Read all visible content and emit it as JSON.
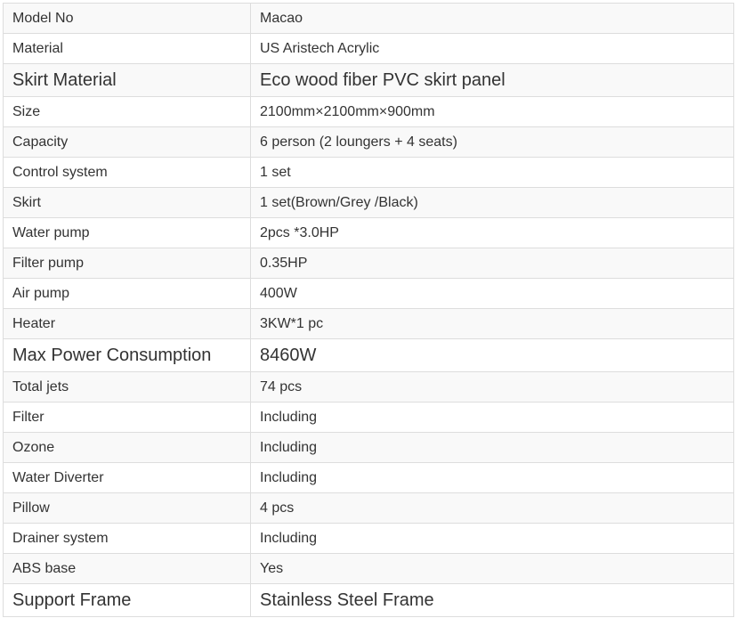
{
  "rows": [
    {
      "label": "Model No",
      "value": "Macao",
      "big": false
    },
    {
      "label": "Material",
      "value": "US Aristech Acrylic",
      "big": false
    },
    {
      "label": "Skirt Material",
      "value": "Eco wood fiber PVC skirt panel",
      "big": true
    },
    {
      "label": "Size",
      "value": "2100mm×2100mm×900mm",
      "big": false
    },
    {
      "label": "Capacity",
      "value": "6 person (2 loungers + 4 seats)",
      "big": false
    },
    {
      "label": "Control system",
      "value": "1 set",
      "big": false
    },
    {
      "label": "Skirt",
      "value": "1 set(Brown/Grey /Black)",
      "big": false
    },
    {
      "label": "Water pump",
      "value": "2pcs *3.0HP",
      "big": false
    },
    {
      "label": "Filter pump",
      "value": "0.35HP",
      "big": false
    },
    {
      "label": "Air pump",
      "value": "400W",
      "big": false
    },
    {
      "label": "Heater",
      "value": "3KW*1 pc",
      "big": false
    },
    {
      "label": "Max Power Consumption",
      "value": "8460W",
      "big": true
    },
    {
      "label": "Total jets",
      "value": "74 pcs",
      "big": false
    },
    {
      "label": "Filter",
      "value": "Including",
      "big": false
    },
    {
      "label": "Ozone",
      "value": "Including",
      "big": false
    },
    {
      "label": "Water Diverter",
      "value": "Including",
      "big": false
    },
    {
      "label": "Pillow",
      "value": "4 pcs",
      "big": false
    },
    {
      "label": "Drainer system",
      "value": "Including",
      "big": false
    },
    {
      "label": "ABS base",
      "value": "Yes",
      "big": false
    },
    {
      "label": "Support Frame",
      "value": "Stainless Steel Frame",
      "big": true
    }
  ],
  "colors": {
    "border": "#dddddd",
    "text": "#333333",
    "stripe": "#f9f9f9"
  }
}
